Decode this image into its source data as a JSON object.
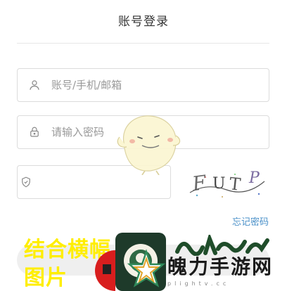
{
  "page": {
    "title": "账号登录"
  },
  "form": {
    "account_placeholder": "账号/手机/邮箱",
    "password_placeholder": "请输入密码",
    "captcha_placeholder": "",
    "captcha_text": "FUTP",
    "forgot_label": "忘记密码"
  },
  "overlay": {
    "banner_line1": "结合横幅",
    "banner_line2": "图片",
    "watermark_name": "魄力手游网",
    "watermark_sub": "plightv.cc"
  },
  "colors": {
    "accent_link": "#4a90c8",
    "banner_text": "#ffee00",
    "border": "#dcdcdc"
  },
  "icons": {
    "account": "user-icon",
    "password": "lock-icon",
    "captcha": "shield-icon"
  }
}
